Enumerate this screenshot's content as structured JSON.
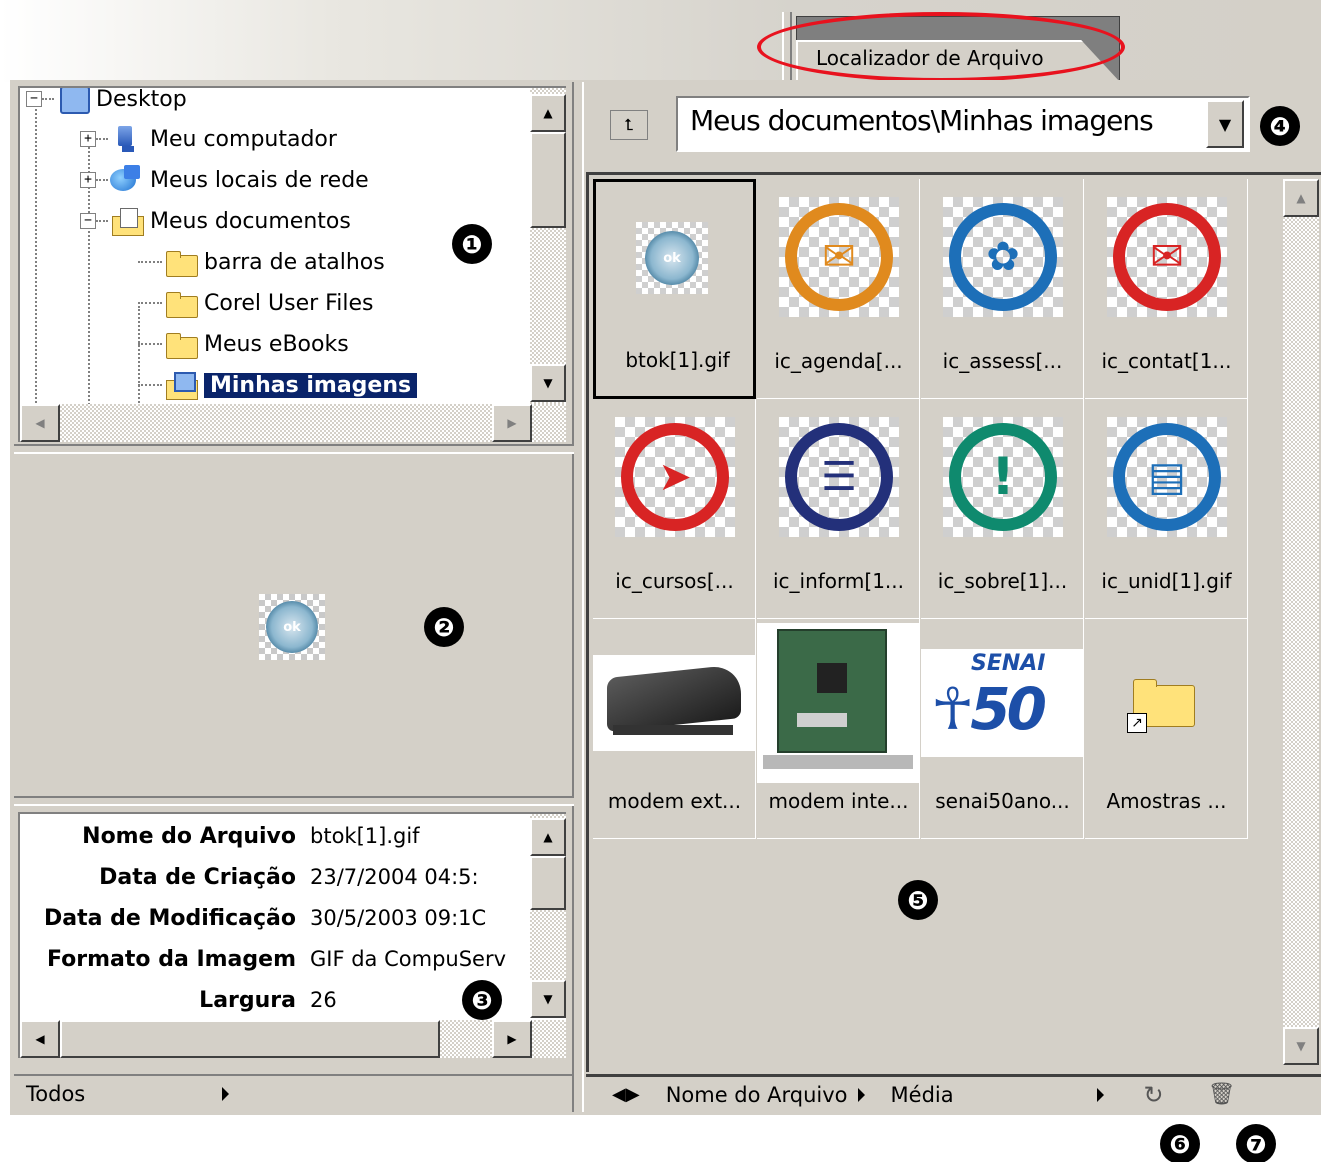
{
  "tab": {
    "label": "Localizador de Arquivo"
  },
  "folder_tree": {
    "items": [
      {
        "label": "Desktop",
        "expander": "−"
      },
      {
        "label": "Meu computador",
        "expander": "+"
      },
      {
        "label": "Meus locais de rede",
        "expander": "+"
      },
      {
        "label": "Meus documentos",
        "expander": "−"
      },
      {
        "label": "barra de atalhos"
      },
      {
        "label": "Corel User Files"
      },
      {
        "label": "Meus eBooks"
      },
      {
        "label": "Minhas imagens"
      }
    ]
  },
  "preview": {
    "image_text": "ok"
  },
  "file_info": {
    "rows": [
      {
        "key": "Nome do Arquivo",
        "value": "btok[1].gif"
      },
      {
        "key": "Data de Criação",
        "value": "23/7/2004 04:5:"
      },
      {
        "key": "Data de Modificação",
        "value": "30/5/2003 09:1C"
      },
      {
        "key": "Formato da Imagem",
        "value": "GIF da CompuServ"
      },
      {
        "key": "Largura",
        "value": "26"
      }
    ]
  },
  "left_status": {
    "filter": "Todos"
  },
  "path_bar": {
    "path": "Meus documentos\\Minhas imagens",
    "up_icon": "folder-up-icon"
  },
  "thumbnails": [
    {
      "label": "btok[1].gif",
      "icon": "ok-icon"
    },
    {
      "label": "ic_agenda[...",
      "icon": "agenda-icon",
      "color": "#e08a1e"
    },
    {
      "label": "ic_assess[...",
      "icon": "assess-icon",
      "color": "#1d6fb8"
    },
    {
      "label": "ic_contat[1...",
      "icon": "contact-icon",
      "color": "#d82424"
    },
    {
      "label": "ic_cursos[...",
      "icon": "cursos-icon",
      "color": "#d82424"
    },
    {
      "label": "ic_inform[1...",
      "icon": "inform-icon",
      "color": "#23307a"
    },
    {
      "label": "ic_sobre[1]...",
      "icon": "sobre-icon",
      "color": "#0f8a6e"
    },
    {
      "label": "ic_unid[1].gif",
      "icon": "unid-icon",
      "color": "#1d6fb8"
    },
    {
      "label": "modem ext...",
      "icon": "modem-external-photo"
    },
    {
      "label": "modem inte...",
      "icon": "modem-internal-photo"
    },
    {
      "label": "senai50ano...",
      "icon": "senai-logo",
      "text": "SENAI"
    },
    {
      "label": "Amostras ...",
      "icon": "folder-shortcut-icon"
    }
  ],
  "right_status": {
    "sort_label": "Nome do Arquivo",
    "size_label": "Média"
  },
  "callouts": [
    "❶",
    "❷",
    "❸",
    "❹",
    "❺",
    "❻",
    "❼"
  ]
}
